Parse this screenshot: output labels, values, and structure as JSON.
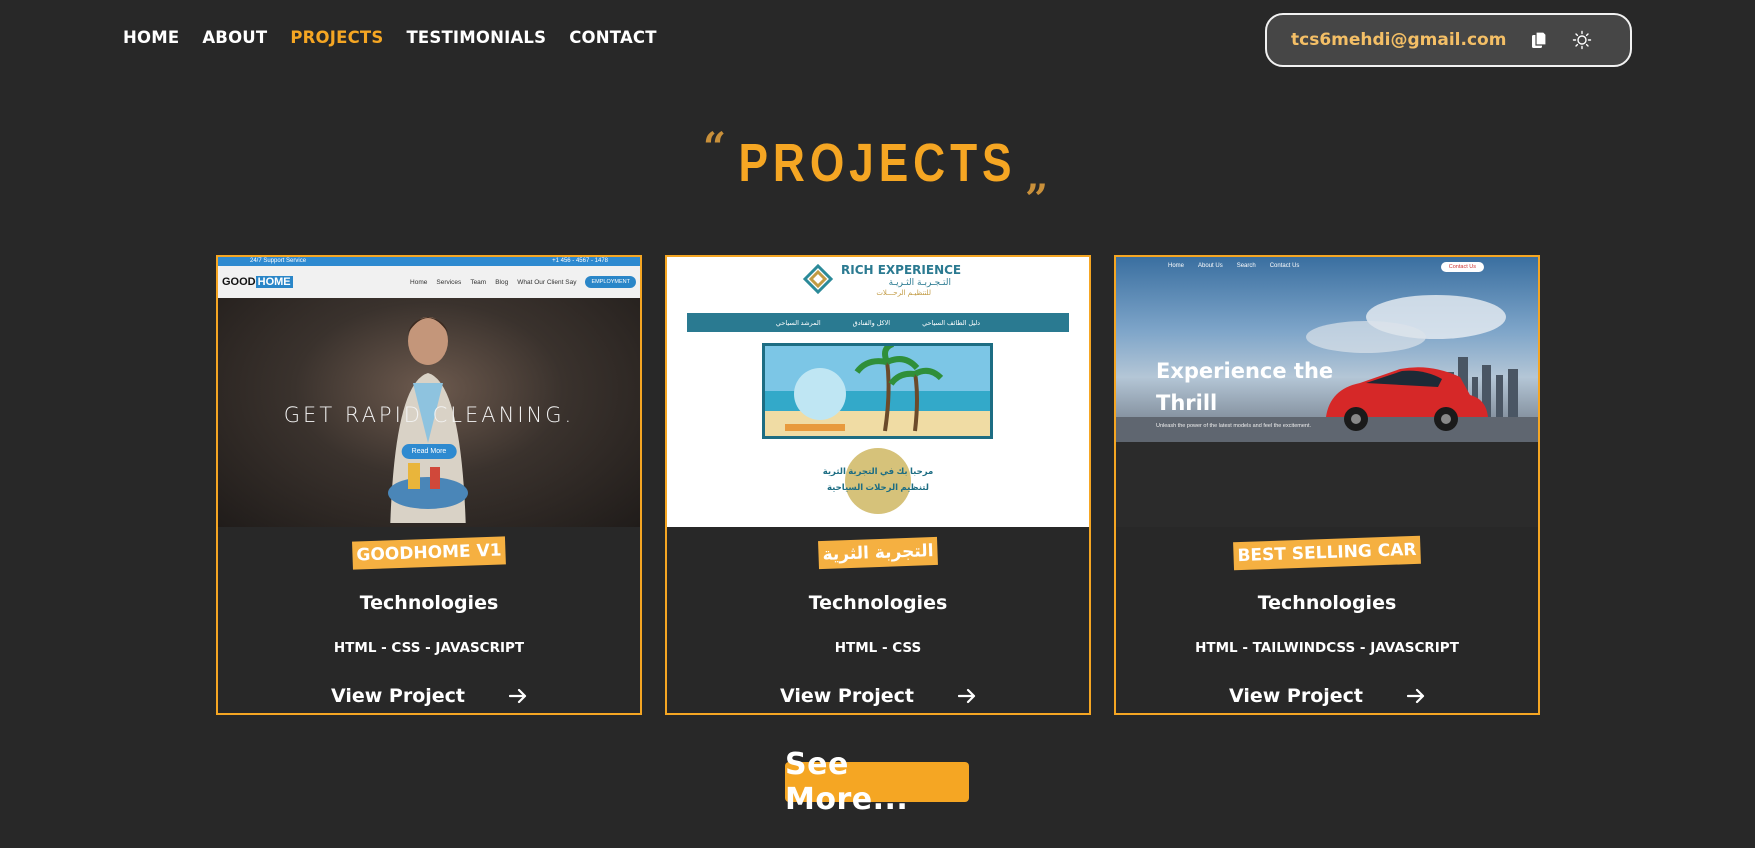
{
  "nav": {
    "items": [
      {
        "label": "HOME",
        "active": false
      },
      {
        "label": "ABOUT",
        "active": false
      },
      {
        "label": "PROJECTS",
        "active": true
      },
      {
        "label": "TESTIMONIALS",
        "active": false
      },
      {
        "label": "CONTACT",
        "active": false
      }
    ]
  },
  "contact": {
    "email": "tcs6mehdi@gmail.com",
    "copy_icon": "copy-icon",
    "theme_icon": "sun-icon"
  },
  "section": {
    "title": "PROJECTS",
    "open_quote": "“",
    "close_quote": "”"
  },
  "projects": [
    {
      "tag": "GOODHOME V1",
      "tech_title": "Technologies",
      "tech_list": "HTML - CSS - JAVASCRIPT",
      "view_label": "View Project",
      "preview": {
        "top_left": "24/7 Support Service",
        "top_right": "+1 456 - 4567 - 1478",
        "logo_a": "GOOD",
        "logo_b": "HOME",
        "links": [
          "Home",
          "Services",
          "Team",
          "Blog",
          "What Our Client Say"
        ],
        "cta": "EMPLOYMENT",
        "headline": "GET RAPID CLEANING.",
        "button": "Read More"
      }
    },
    {
      "tag": "التجربة الثرية",
      "tech_title": "Technologies",
      "tech_list": "HTML - CSS",
      "view_label": "View Project",
      "preview": {
        "logo_en": "RICH EXPERIENCE",
        "logo_ar": "التـجـربـة الثـريـة",
        "logo_sub": "للتنظيـم الرحـــلات",
        "menu": [
          "دليل الطائف السياحي",
          "الاكل والفنادق",
          "المرشد السياحي"
        ],
        "line1": "مرحبا بك في التجربة الثرية",
        "line2": "لتنظيم الرحلات السياحية"
      }
    },
    {
      "tag": "BEST SELLING CAR",
      "tech_title": "Technologies",
      "tech_list": "HTML - TAILWINDCSS - JAVASCRIPT",
      "view_label": "View Project",
      "preview": {
        "links": [
          "Home",
          "About Us",
          "Search",
          "Contact Us"
        ],
        "cta": "Contact Us",
        "headline_1": "Experience the",
        "headline_2": "Thrill",
        "sub": "Unleash the power of the latest models and feel the excitement."
      }
    }
  ],
  "see_more": "See More..."
}
